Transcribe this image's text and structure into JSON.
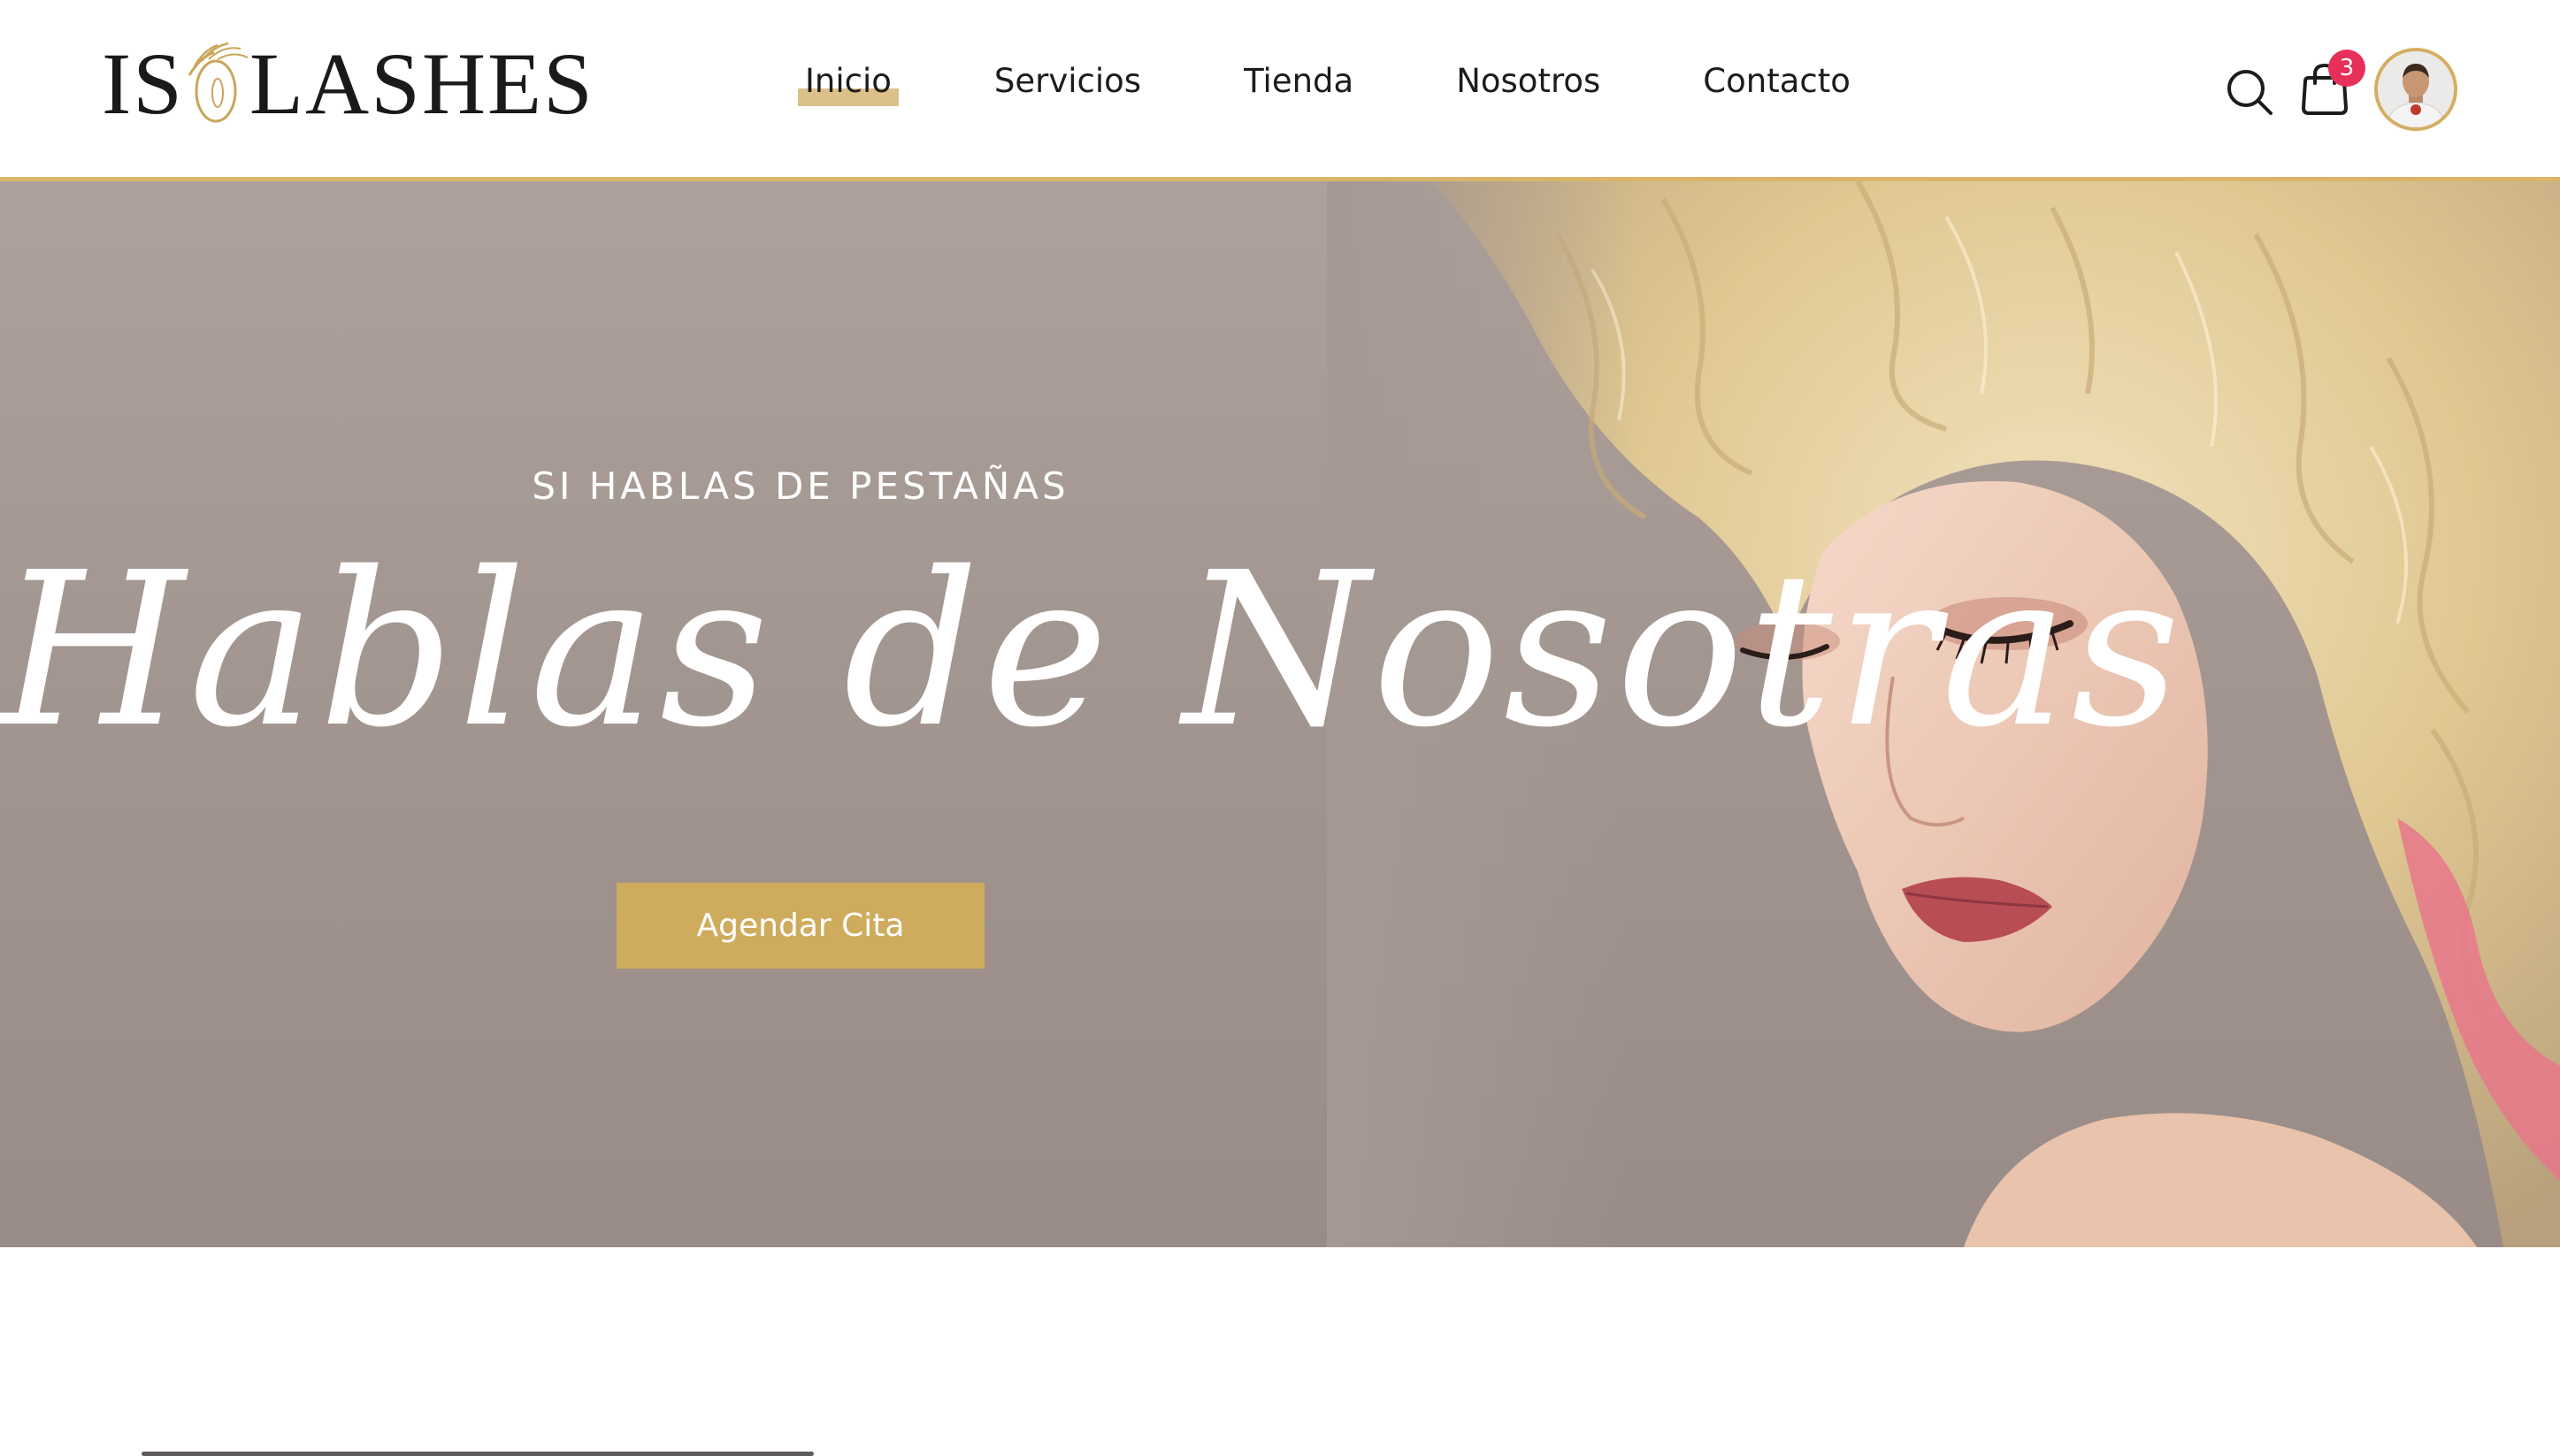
{
  "brand": {
    "logo_left": "IS",
    "logo_right": "LASHES",
    "accent_color": "#cfab5d",
    "badge_color": "#e6305a"
  },
  "nav": {
    "items": [
      {
        "label": "Inicio",
        "active": true
      },
      {
        "label": "Servicios",
        "active": false
      },
      {
        "label": "Tienda",
        "active": false
      },
      {
        "label": "Nosotros",
        "active": false
      },
      {
        "label": "Contacto",
        "active": false
      }
    ]
  },
  "header_actions": {
    "search_icon": "search-icon",
    "cart_icon": "shopping-bag-icon",
    "cart_count": "3",
    "avatar": "user-avatar"
  },
  "hero": {
    "kicker": "SI HABLAS DE PESTAÑAS",
    "title": "Hablas de Nosotras",
    "cta_label": "Agendar Cita"
  }
}
